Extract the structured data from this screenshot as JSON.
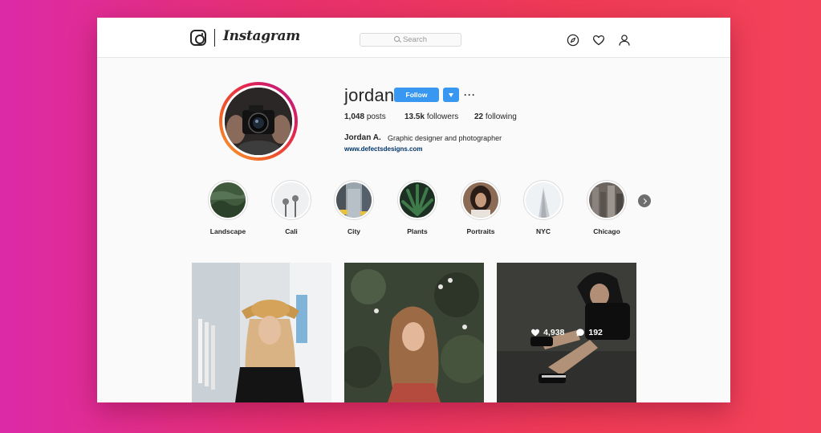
{
  "header": {
    "brand": "Instagram",
    "search_placeholder": "Search",
    "icons": [
      "compass-icon",
      "heart-icon",
      "person-icon"
    ]
  },
  "profile": {
    "username": "jordan",
    "follow_label": "Follow",
    "more_label": "···",
    "stats": {
      "posts_count": "1,048",
      "posts_label": "posts",
      "followers_count": "13.5k",
      "followers_label": "followers",
      "following_count": "22",
      "following_label": "following"
    },
    "full_name": "Jordan A.",
    "bio": "Graphic designer and photographer",
    "website": "www.defectsdesigns.com"
  },
  "highlights": [
    {
      "label": "Landscape"
    },
    {
      "label": "Cali"
    },
    {
      "label": "City"
    },
    {
      "label": "Plants"
    },
    {
      "label": "Portraits"
    },
    {
      "label": "NYC"
    },
    {
      "label": "Chicago"
    }
  ],
  "posts": [
    {
      "id": 1
    },
    {
      "id": 2
    },
    {
      "id": 3,
      "likes": "4,938",
      "comments": "192"
    }
  ],
  "colors": {
    "accent_blue": "#3897f0",
    "link_blue": "#003569",
    "background_gradient_start": "#dc2aa7",
    "background_gradient_end": "#f2425a"
  }
}
